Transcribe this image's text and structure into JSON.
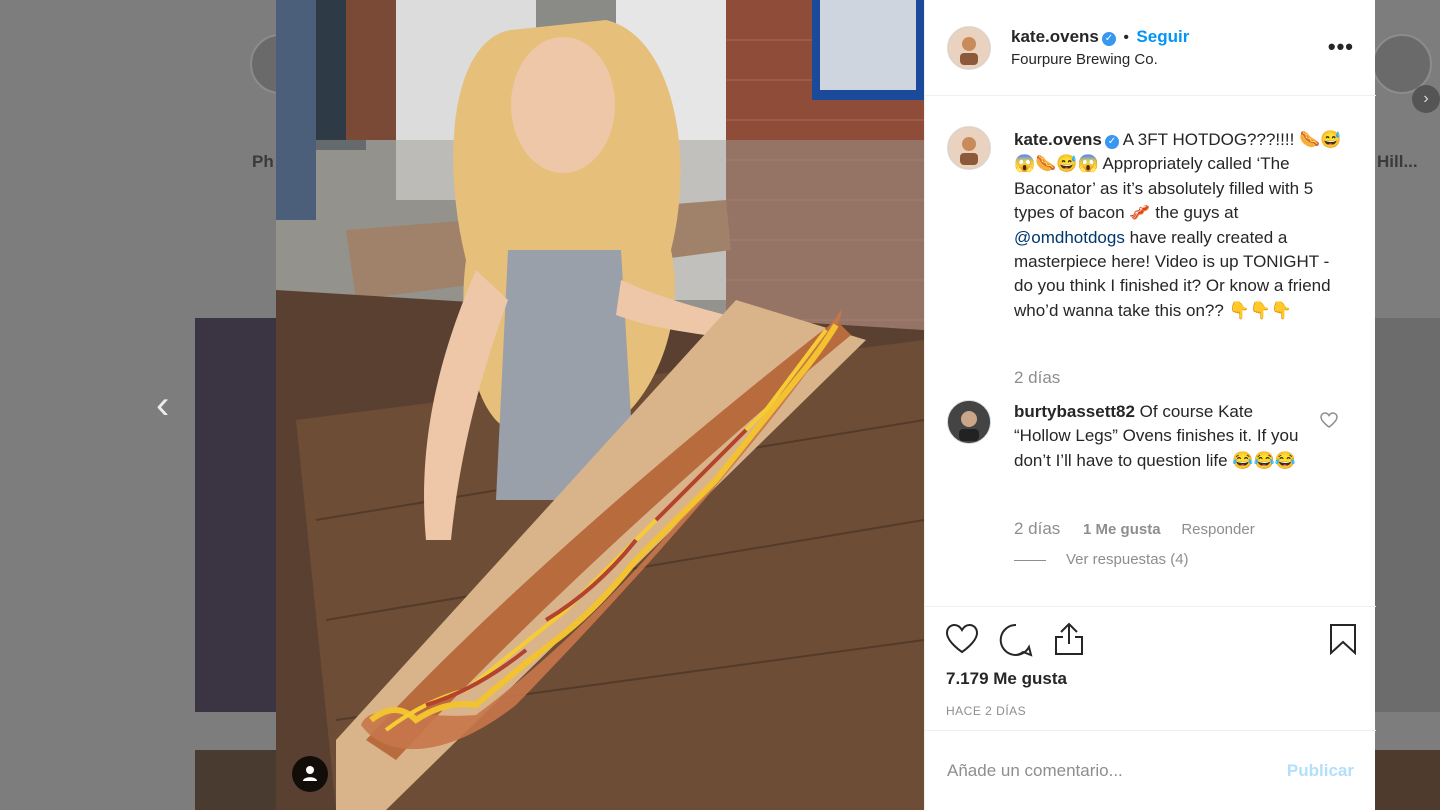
{
  "background": {
    "left_story_label": "Ph",
    "right_story_label": "Hill..."
  },
  "post": {
    "author": "kate.ovens",
    "follow_label": "Seguir",
    "location": "Fourpure Brewing Co.",
    "more_label": "•••",
    "caption": "A 3FT HOTDOG???!!!! 🌭😅😱🌭😅😱 Appropriately called ‘The Baconator’ as it’s absolutely filled with 5 types of bacon 🥓 the guys at",
    "caption_mention": "@omdhotdogs",
    "caption_tail": "have really created a masterpiece here! Video is up TONIGHT - do you think I finished it? Or know a friend who’d wanna take this on?? 👇👇👇",
    "caption_age": "2 días",
    "likes": "7.179 Me gusta",
    "timestamp": "HACE 2 DÍAS"
  },
  "comment": {
    "author": "burtybassett82",
    "text": "Of course Kate “Hollow Legs” Ovens finishes it. If you don’t I’ll have to question life 😂😂😂",
    "age": "2 días",
    "likes": "1 Me gusta",
    "reply_label": "Responder",
    "view_replies": "Ver respuestas (4)"
  },
  "add_comment": {
    "placeholder": "Añade un comentario...",
    "publish_label": "Publicar"
  },
  "colors": {
    "accent": "#0095f6",
    "verified": "#3897f0",
    "publish_disabled": "#b2dffc"
  }
}
